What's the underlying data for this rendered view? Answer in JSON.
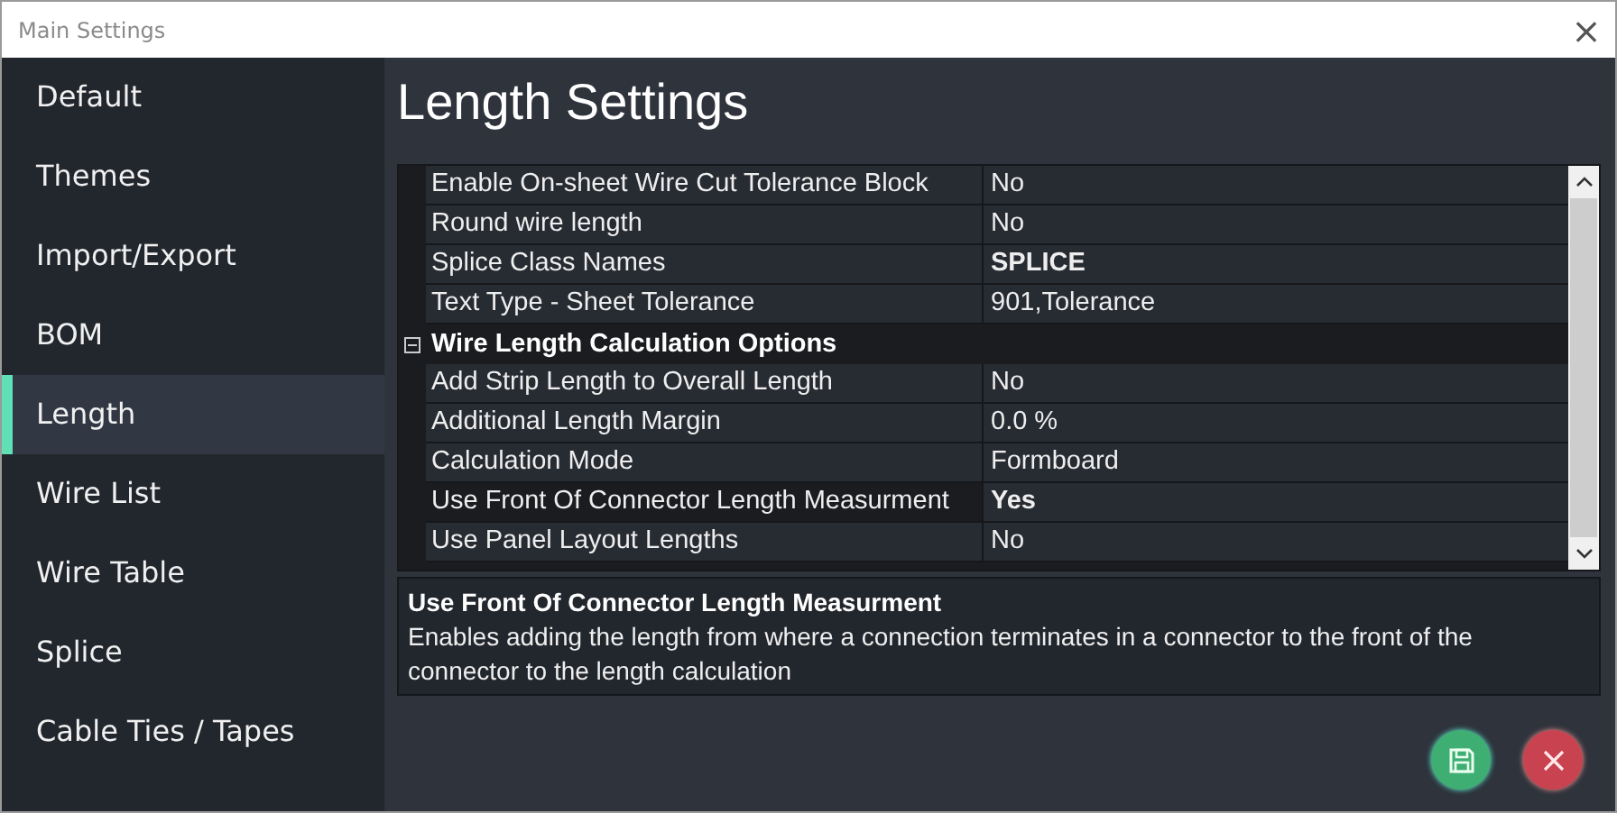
{
  "window": {
    "title": "Main Settings",
    "close": "×"
  },
  "sidebar": {
    "items": [
      {
        "label": "Default",
        "selected": false
      },
      {
        "label": "Themes",
        "selected": false
      },
      {
        "label": "Import/Export",
        "selected": false
      },
      {
        "label": "BOM",
        "selected": false
      },
      {
        "label": "Length",
        "selected": true
      },
      {
        "label": "Wire List",
        "selected": false
      },
      {
        "label": "Wire Table",
        "selected": false
      },
      {
        "label": "Splice",
        "selected": false
      },
      {
        "label": "Cable Ties / Tapes",
        "selected": false
      }
    ]
  },
  "heading": "Length Settings",
  "grid": {
    "rows": [
      {
        "kind": "property",
        "name": "Enable On-sheet Wire Cut Tolerance Block",
        "value": "No",
        "modified": false,
        "selected": false
      },
      {
        "kind": "property",
        "name": "Round wire length",
        "value": "No",
        "modified": false,
        "selected": false
      },
      {
        "kind": "property",
        "name": "Splice Class Names",
        "value": "SPLICE",
        "modified": true,
        "selected": false
      },
      {
        "kind": "property",
        "name": "Text Type - Sheet Tolerance",
        "value": "901,Tolerance",
        "modified": false,
        "selected": false
      },
      {
        "kind": "category",
        "name": "Wire Length Calculation Options",
        "expanded": true
      },
      {
        "kind": "property",
        "name": "Add Strip Length to Overall Length",
        "value": "No",
        "modified": false,
        "selected": false
      },
      {
        "kind": "property",
        "name": "Additional Length Margin",
        "value": "0.0 %",
        "modified": false,
        "selected": false
      },
      {
        "kind": "property",
        "name": "Calculation Mode",
        "value": "Formboard",
        "modified": false,
        "selected": false
      },
      {
        "kind": "property",
        "name": "Use Front Of Connector Length Measurment",
        "value": "Yes",
        "modified": true,
        "selected": true
      },
      {
        "kind": "property",
        "name": "Use Panel Layout Lengths",
        "value": "No",
        "modified": false,
        "selected": false
      }
    ]
  },
  "description": {
    "title": "Use Front Of Connector Length Measurment",
    "text": "Enables adding the length from where a connection terminates in a connector to the front of the connector to the length calculation"
  }
}
